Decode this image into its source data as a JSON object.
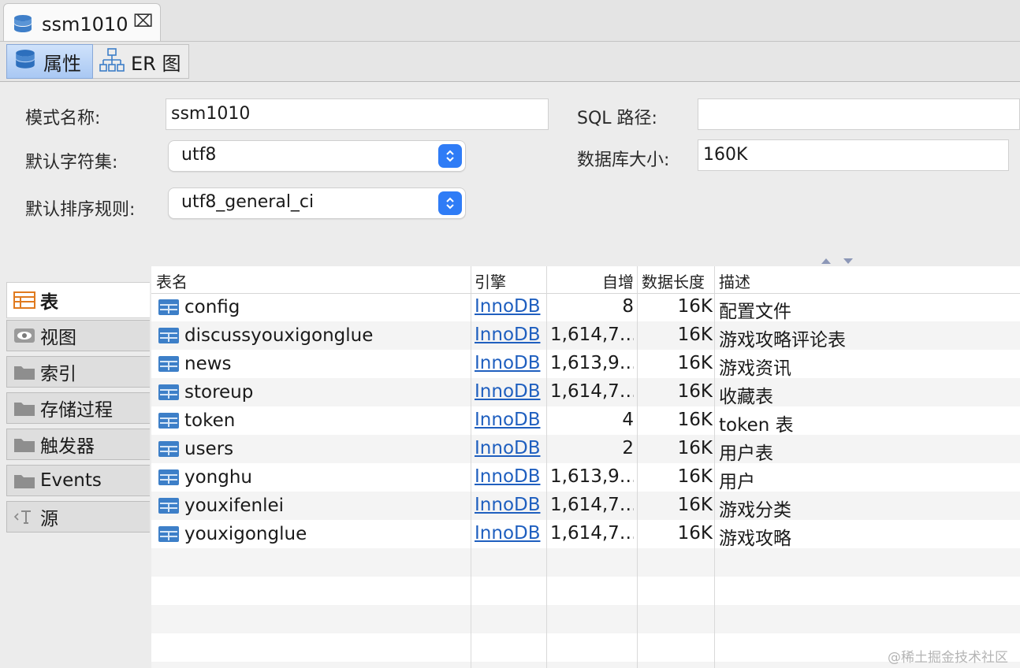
{
  "tab": {
    "title": "ssm1010",
    "close_glyph": "⌧",
    "icon": "database-icon"
  },
  "subtabs": [
    {
      "label": "属性",
      "icon": "database-icon",
      "active": true
    },
    {
      "label": "ER 图",
      "icon": "er-diagram-icon",
      "active": false
    }
  ],
  "form": {
    "schema_name_label": "模式名称:",
    "schema_name_value": "ssm1010",
    "charset_label": "默认字符集:",
    "charset_value": "utf8",
    "collation_label": "默认排序规则:",
    "collation_value": "utf8_general_ci",
    "sql_path_label": "SQL 路径:",
    "sql_path_value": "",
    "db_size_label": "数据库大小:",
    "db_size_value": "160K"
  },
  "sidebar": {
    "items": [
      {
        "label": "表",
        "icon": "table-icon",
        "active": true
      },
      {
        "label": "视图",
        "icon": "eye-icon",
        "active": false
      },
      {
        "label": "索引",
        "icon": "folder-icon",
        "active": false
      },
      {
        "label": "存储过程",
        "icon": "folder-icon",
        "active": false
      },
      {
        "label": "触发器",
        "icon": "folder-icon",
        "active": false
      },
      {
        "label": "Events",
        "icon": "folder-icon",
        "active": false
      },
      {
        "label": "源",
        "icon": "source-icon",
        "active": false
      }
    ]
  },
  "table": {
    "headers": {
      "name": "表名",
      "engine": "引擎",
      "auto_increment": "自增",
      "data_length": "数据长度",
      "comment": "描述"
    },
    "rows": [
      {
        "name": "config",
        "engine": "InnoDB",
        "auto_increment": "8",
        "data_length": "16K",
        "comment": "配置文件"
      },
      {
        "name": "discussyouxigonglue",
        "engine": "InnoDB",
        "auto_increment": "1,614,7…",
        "data_length": "16K",
        "comment": "游戏攻略评论表"
      },
      {
        "name": "news",
        "engine": "InnoDB",
        "auto_increment": "1,613,9…",
        "data_length": "16K",
        "comment": "游戏资讯"
      },
      {
        "name": "storeup",
        "engine": "InnoDB",
        "auto_increment": "1,614,7…",
        "data_length": "16K",
        "comment": "收藏表"
      },
      {
        "name": "token",
        "engine": "InnoDB",
        "auto_increment": "4",
        "data_length": "16K",
        "comment": "token 表"
      },
      {
        "name": "users",
        "engine": "InnoDB",
        "auto_increment": "2",
        "data_length": "16K",
        "comment": "用户表"
      },
      {
        "name": "yonghu",
        "engine": "InnoDB",
        "auto_increment": "1,613,9…",
        "data_length": "16K",
        "comment": "用户"
      },
      {
        "name": "youxifenlei",
        "engine": "InnoDB",
        "auto_increment": "1,614,7…",
        "data_length": "16K",
        "comment": "游戏分类"
      },
      {
        "name": "youxigonglue",
        "engine": "InnoDB",
        "auto_increment": "1,614,7…",
        "data_length": "16K",
        "comment": "游戏攻略"
      }
    ]
  },
  "watermark": "@稀土掘金技术社区",
  "colors": {
    "accent": "#2f7cf6",
    "link": "#1f5fbf",
    "table_icon": "#3d7fc8"
  }
}
